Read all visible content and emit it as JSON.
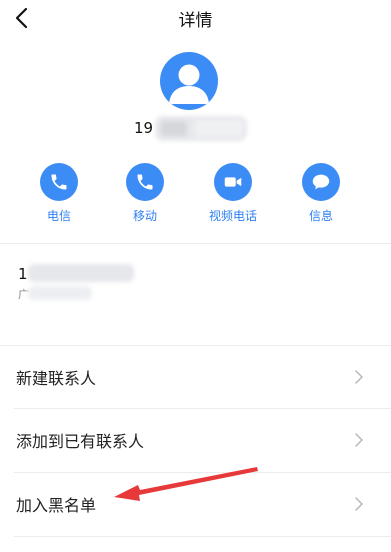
{
  "header": {
    "title": "详情"
  },
  "contact": {
    "number_prefix": "19",
    "detail_prefix_line1": "1",
    "detail_prefix_line2": "广"
  },
  "actions": [
    {
      "label": "电信",
      "icon": "phone-icon"
    },
    {
      "label": "移动",
      "icon": "phone-icon"
    },
    {
      "label": "视频电话",
      "icon": "video-camera-icon"
    },
    {
      "label": "信息",
      "icon": "message-icon"
    }
  ],
  "menu": [
    {
      "label": "新建联系人"
    },
    {
      "label": "添加到已有联系人"
    },
    {
      "label": "加入黑名单"
    }
  ],
  "colors": {
    "accent": "#3c8cf5",
    "action_text": "#2f7ff2",
    "annotation": "#e8393a"
  }
}
